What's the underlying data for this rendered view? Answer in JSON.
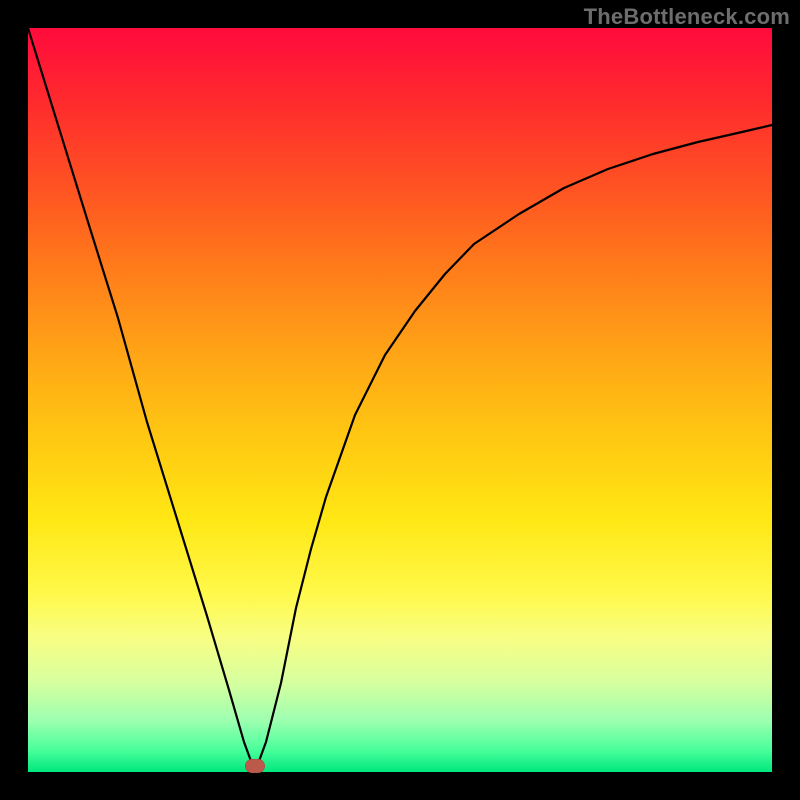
{
  "watermark": "TheBottleneck.com",
  "marker": {
    "x_pct": 30.5,
    "y_pct": 99.2
  },
  "chart_data": {
    "type": "line",
    "title": "",
    "xlabel": "",
    "ylabel": "",
    "xlim": [
      0,
      100
    ],
    "ylim": [
      0,
      100
    ],
    "series": [
      {
        "name": "curve",
        "x": [
          0,
          4,
          8,
          12,
          16,
          20,
          24,
          27,
          29,
          30.5,
          32,
          34,
          36,
          38,
          40,
          44,
          48,
          52,
          56,
          60,
          66,
          72,
          78,
          84,
          90,
          96,
          100
        ],
        "y": [
          100,
          87,
          74,
          61,
          47,
          34,
          21,
          11,
          4,
          0,
          4,
          12,
          22,
          30,
          37,
          48,
          56,
          62,
          67,
          71,
          75,
          78.5,
          81,
          83,
          84.7,
          86,
          87
        ]
      }
    ],
    "annotations": [
      {
        "type": "marker",
        "x": 30.5,
        "y": 0.8,
        "color": "#bb594b"
      }
    ],
    "background_gradient": {
      "type": "vertical",
      "stops": [
        {
          "pct": 0,
          "color": "#ff0a3c"
        },
        {
          "pct": 50,
          "color": "#ffb714"
        },
        {
          "pct": 78,
          "color": "#fff94a"
        },
        {
          "pct": 100,
          "color": "#00e77e"
        }
      ]
    }
  }
}
